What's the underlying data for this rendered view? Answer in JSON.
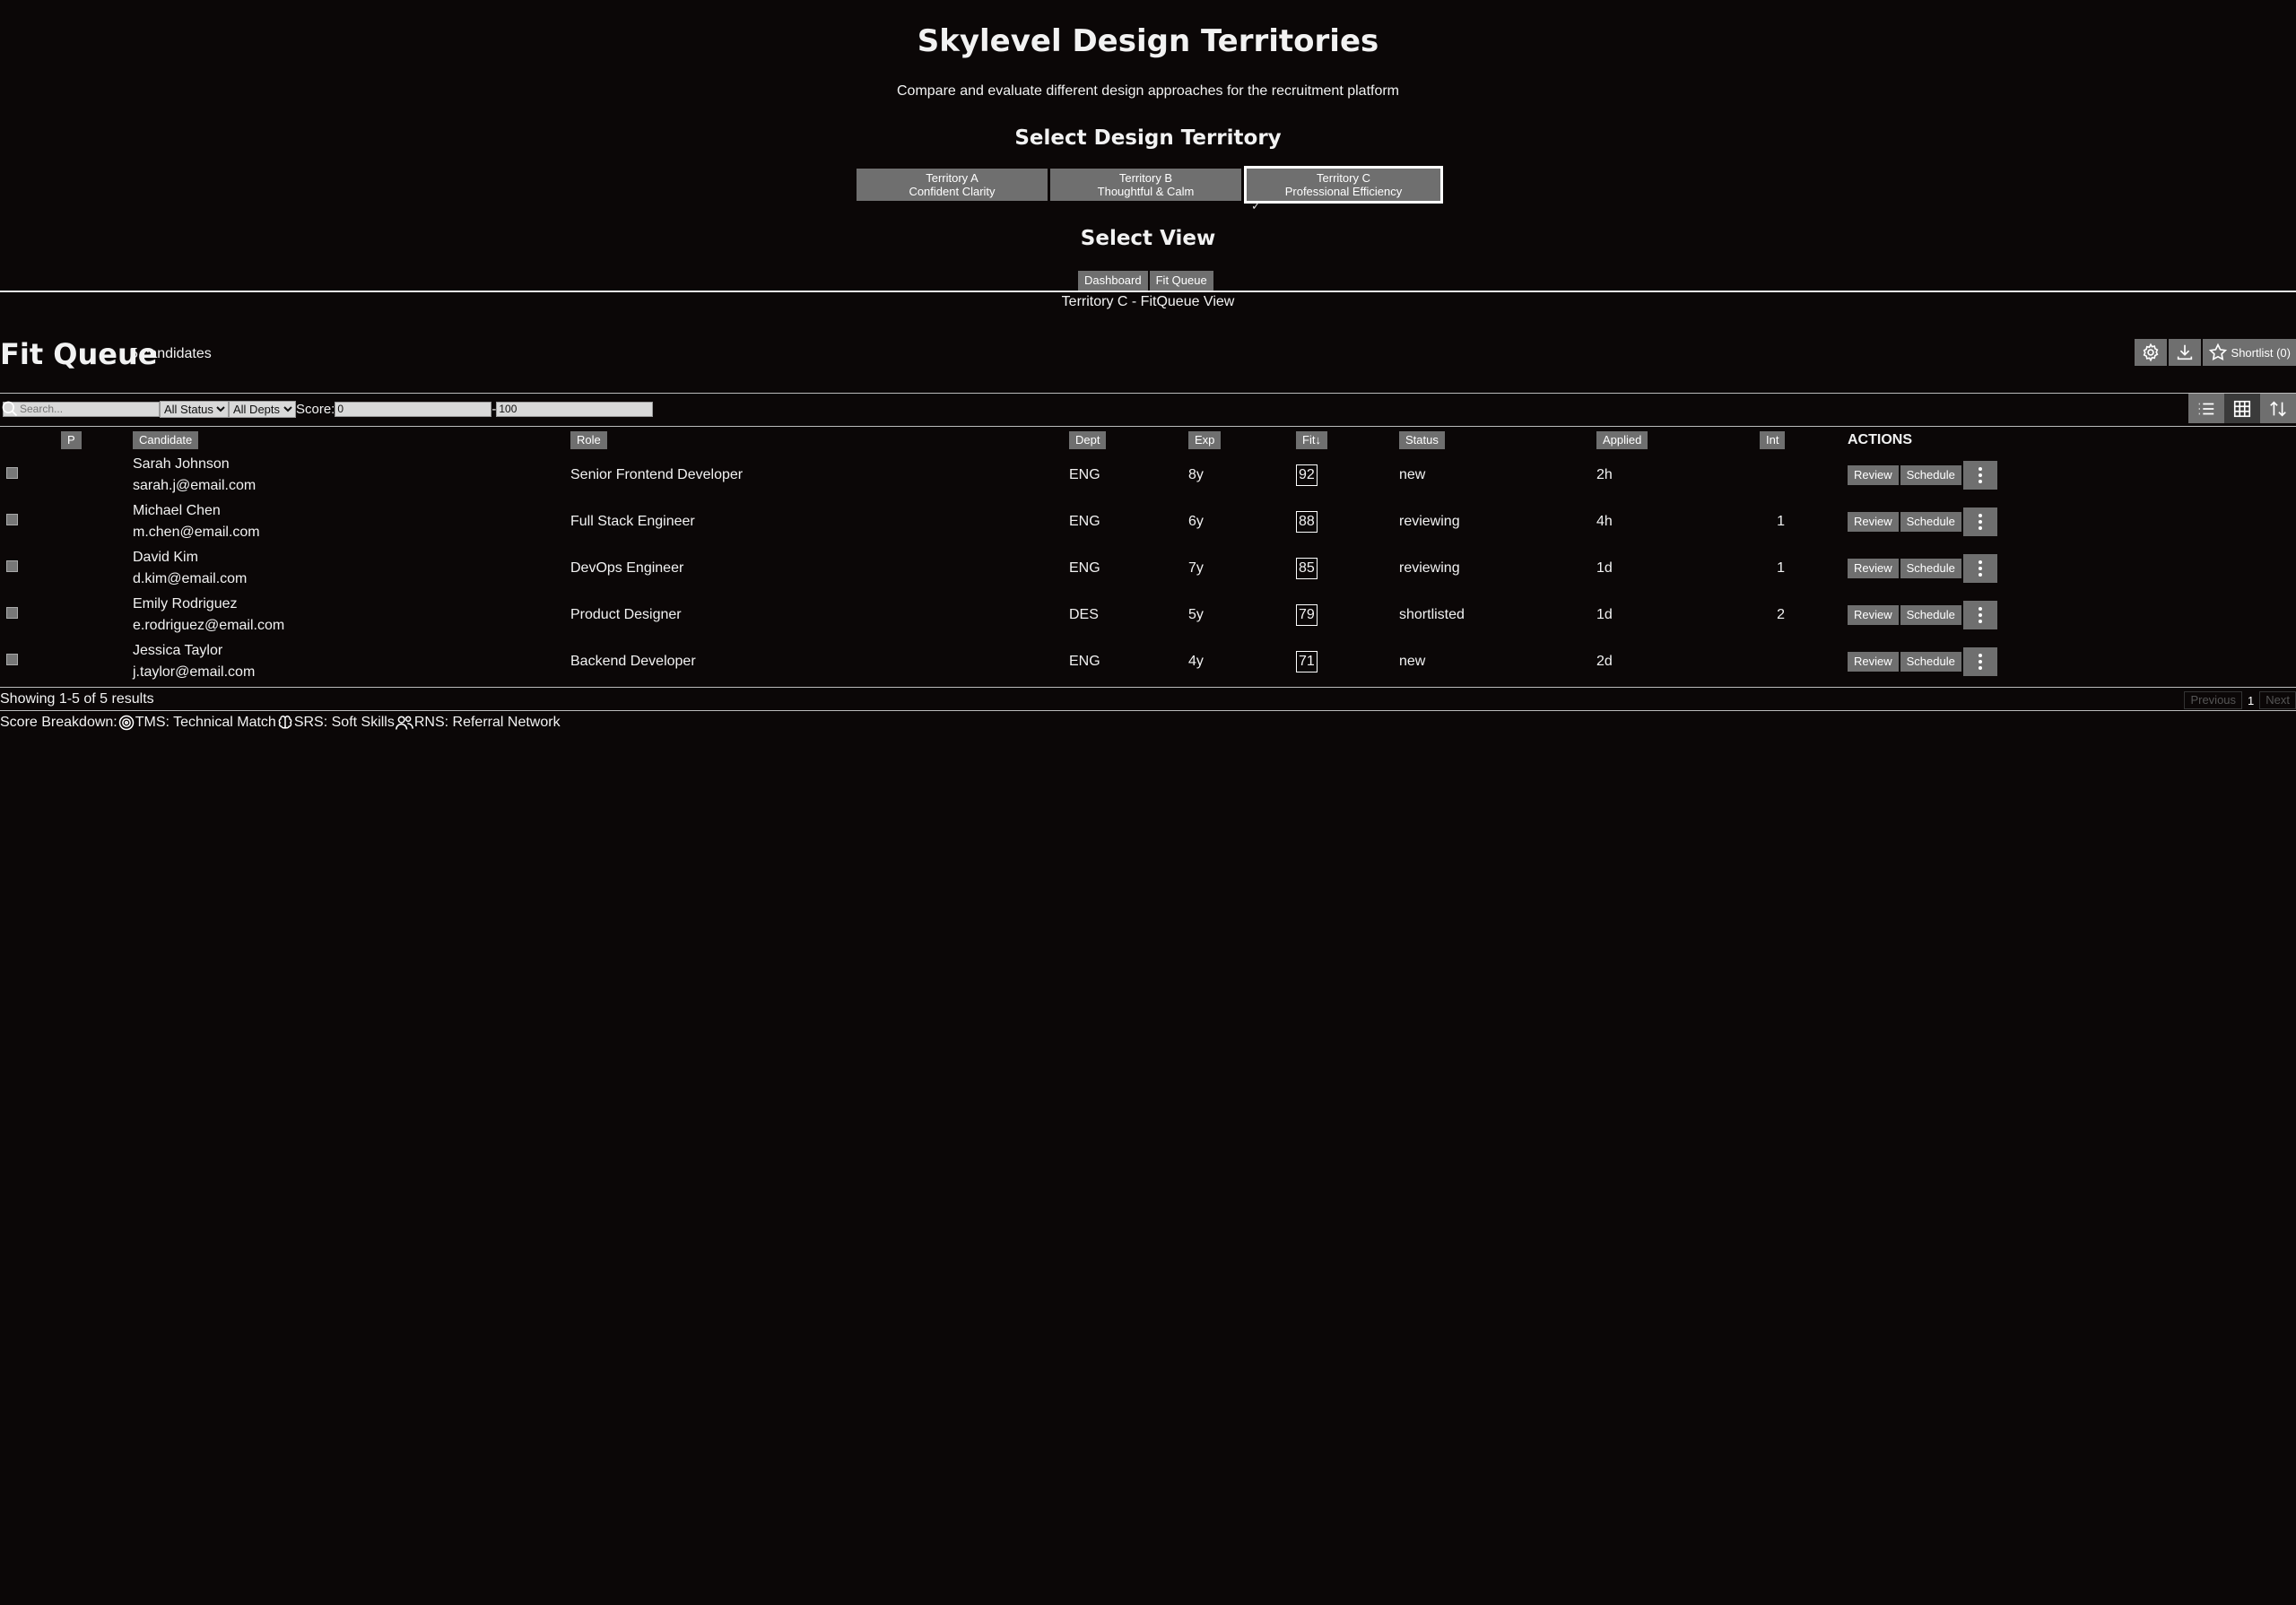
{
  "header": {
    "title": "Skylevel Design Territories",
    "subtitle": "Compare and evaluate different design approaches for the recruitment platform"
  },
  "territory_section": {
    "heading": "Select Design Territory",
    "options": [
      {
        "line1": "Territory A",
        "line2": "Confident Clarity"
      },
      {
        "line1": "Territory B",
        "line2": "Thoughtful & Calm"
      },
      {
        "line1": "Territory C",
        "line2": "Professional Efficiency"
      }
    ],
    "selected_mark": "✓"
  },
  "view_section": {
    "heading": "Select View",
    "options": [
      "Dashboard",
      "Fit Queue"
    ]
  },
  "view_caption": "Territory C - FitQueue View",
  "fit_queue": {
    "title": "Fit Queue",
    "count_label": "5 candidates",
    "shortlist_label": "Shortlist (0)"
  },
  "filters": {
    "search_placeholder": "Search...",
    "status_selected": "All Status",
    "dept_selected": "All Depts",
    "score_label": "Score:",
    "score_min": "0",
    "score_sep": "-",
    "score_max": "100"
  },
  "columns": {
    "p": "P",
    "candidate": "Candidate",
    "role": "Role",
    "dept": "Dept",
    "exp": "Exp",
    "fit": "Fit↓",
    "status": "Status",
    "applied": "Applied",
    "int": "Int",
    "actions": "ACTIONS"
  },
  "row_actions": {
    "review": "Review",
    "schedule": "Schedule"
  },
  "candidates": [
    {
      "name": "Sarah Johnson",
      "email": "sarah.j@email.com",
      "role": "Senior Frontend Developer",
      "dept": "ENG",
      "exp": "8y",
      "fit": "92",
      "status": "new",
      "applied": "2h",
      "int": ""
    },
    {
      "name": "Michael Chen",
      "email": "m.chen@email.com",
      "role": "Full Stack Engineer",
      "dept": "ENG",
      "exp": "6y",
      "fit": "88",
      "status": "reviewing",
      "applied": "4h",
      "int": "1"
    },
    {
      "name": "David Kim",
      "email": "d.kim@email.com",
      "role": "DevOps Engineer",
      "dept": "ENG",
      "exp": "7y",
      "fit": "85",
      "status": "reviewing",
      "applied": "1d",
      "int": "1"
    },
    {
      "name": "Emily Rodriguez",
      "email": "e.rodriguez@email.com",
      "role": "Product Designer",
      "dept": "DES",
      "exp": "5y",
      "fit": "79",
      "status": "shortlisted",
      "applied": "1d",
      "int": "2"
    },
    {
      "name": "Jessica Taylor",
      "email": "j.taylor@email.com",
      "role": "Backend Developer",
      "dept": "ENG",
      "exp": "4y",
      "fit": "71",
      "status": "new",
      "applied": "2d",
      "int": ""
    }
  ],
  "pagination": {
    "results_label": "Showing 1-5 of 5 results",
    "previous": "Previous",
    "current": "1",
    "next": "Next"
  },
  "legend": {
    "label": "Score Breakdown:",
    "items": [
      {
        "icon": "target-icon",
        "text": "TMS: Technical Match"
      },
      {
        "icon": "brain-icon",
        "text": "SRS: Soft Skills"
      },
      {
        "icon": "users-icon",
        "text": "RNS: Referral Network"
      }
    ]
  }
}
